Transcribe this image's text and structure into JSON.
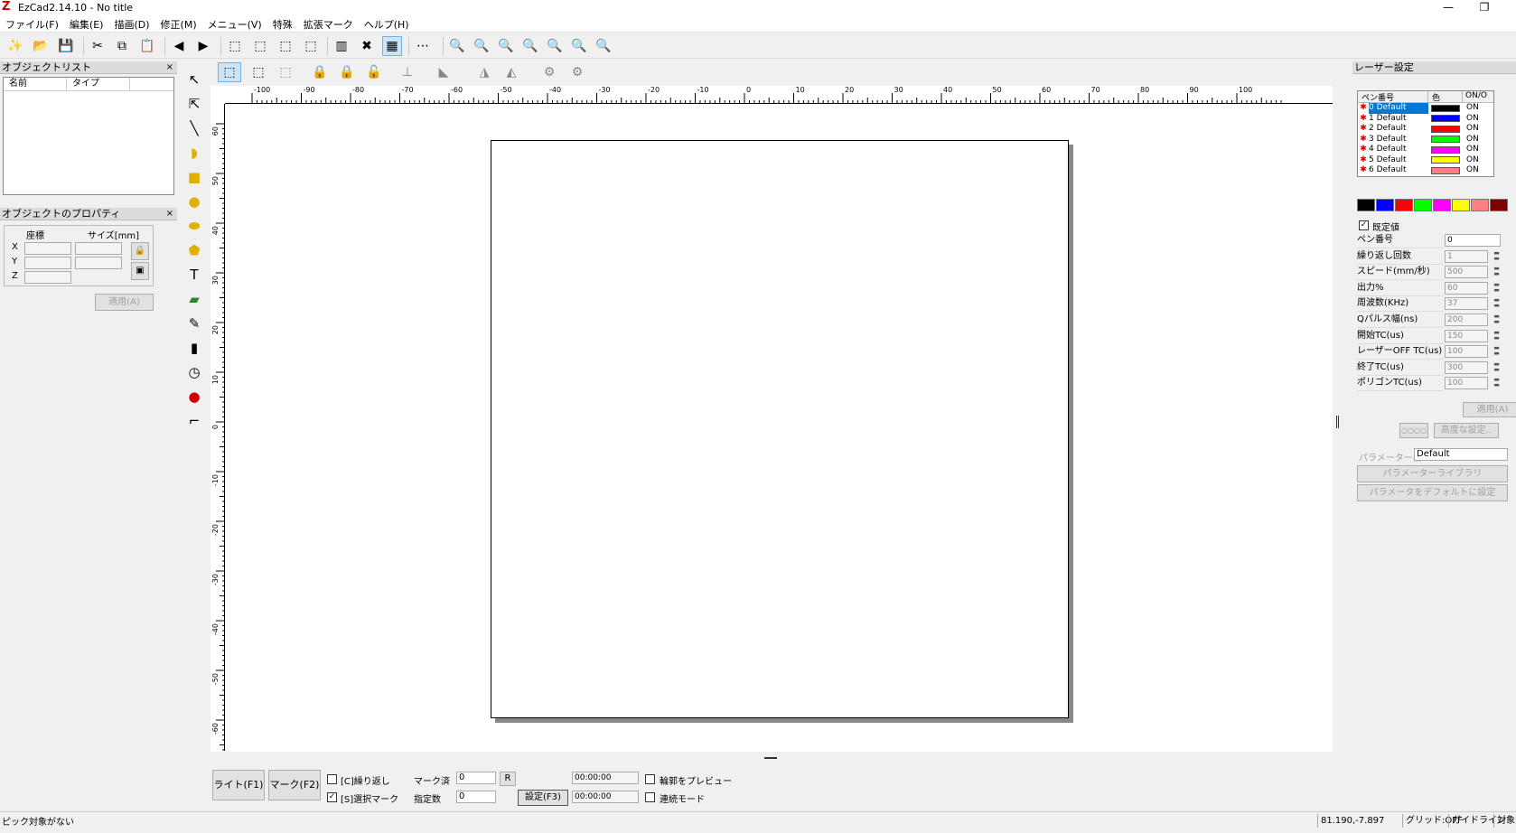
{
  "window": {
    "title": "EzCad2.14.10 - No title",
    "minimize": "—",
    "restore": "❐"
  },
  "menu": [
    "ファイル(F)",
    "編集(E)",
    "描画(D)",
    "修正(M)",
    "メニュー(V)",
    "特殊",
    "拡張マーク",
    "ヘルプ(H)"
  ],
  "object_list": {
    "title": "オブジェクトリスト",
    "close": "×",
    "col_name": "名前",
    "col_type": "タイプ"
  },
  "object_props": {
    "title": "オブジェクトのプロパティ",
    "close": "×",
    "coord_label": "座標",
    "size_label": "サイズ[mm]",
    "x": "X",
    "y": "Y",
    "z": "Z",
    "apply": "適用(A)"
  },
  "ruler": {
    "h_labels": [
      "-100",
      "-90",
      "-80",
      "-70",
      "-60",
      "-50",
      "-40",
      "-30",
      "-20",
      "-10",
      "0",
      "10",
      "20",
      "30",
      "40",
      "50",
      "60",
      "70",
      "80",
      "90",
      "100"
    ],
    "v_labels": [
      "60",
      "50",
      "40",
      "30",
      "20",
      "10",
      "0",
      "-10",
      "-20",
      "-30",
      "-40",
      "-50",
      "-60"
    ]
  },
  "markbar": {
    "light_btn": "ライト(F1)",
    "mark_btn": "マーク(F2)",
    "repeat_label": "[C]繰り返し",
    "select_mark_label": "[S]選択マーク",
    "marked_label": "マーク済",
    "marked_value": "0",
    "r_btn": "R",
    "count_label": "指定数",
    "count_value": "0",
    "settings_btn": "設定(F3)",
    "time1": "00:00:00",
    "time2": "00:00:00",
    "preview_label": "輪郭をプレビュー",
    "continuous_label": "連続モード",
    "repeat_checked": false,
    "select_mark_checked": true
  },
  "laser": {
    "title": "レーザー設定",
    "hdr_pen": "ペン番号",
    "hdr_color": "色",
    "hdr_on": "ON/O",
    "pens": [
      {
        "name": "0 Default",
        "color": "#000000",
        "on": "ON"
      },
      {
        "name": "1 Default",
        "color": "#0000ff",
        "on": "ON"
      },
      {
        "name": "2 Default",
        "color": "#ff0000",
        "on": "ON"
      },
      {
        "name": "3 Default",
        "color": "#00ff00",
        "on": "ON"
      },
      {
        "name": "4 Default",
        "color": "#ff00ff",
        "on": "ON"
      },
      {
        "name": "5 Default",
        "color": "#ffff00",
        "on": "ON"
      },
      {
        "name": "6 Default",
        "color": "#ff8080",
        "on": "ON"
      }
    ],
    "swatches": [
      "#000000",
      "#0000ff",
      "#ff0000",
      "#00ff00",
      "#ff00ff",
      "#ffff00",
      "#ff8080",
      "#800000"
    ],
    "default_label": "既定値",
    "params": [
      {
        "label": "ペン番号",
        "value": "0"
      },
      {
        "label": "繰り返し回数",
        "value": "1"
      },
      {
        "label": "スピード(mm/秒)",
        "value": "500"
      },
      {
        "label": "出力%",
        "value": "60"
      },
      {
        "label": "周波数(KHz)",
        "value": "37"
      },
      {
        "label": "Qパルス幅(ns)",
        "value": "200"
      },
      {
        "label": "開始TC(us)",
        "value": "150"
      },
      {
        "label": "レーザーOFF TC(us)",
        "value": "100"
      },
      {
        "label": "終了TC(us)",
        "value": "300"
      },
      {
        "label": "ポリゴンTC(us)",
        "value": "100"
      }
    ],
    "apply_btn": "適用(A)",
    "oooo_btn": "○○○○",
    "advanced_btn": "高度な設定..",
    "param_name_label": "パラメーター名",
    "param_name_value": "Default",
    "library_btn": "パラメーターライブラリ",
    "default_btn": "パラメータをデフォルトに設定"
  },
  "status": {
    "msg": "ピック対象がない",
    "coords": "81.190,-7.897",
    "grid": "グリッド:OFF",
    "guide": "ガイドライン",
    "target": "対象"
  }
}
